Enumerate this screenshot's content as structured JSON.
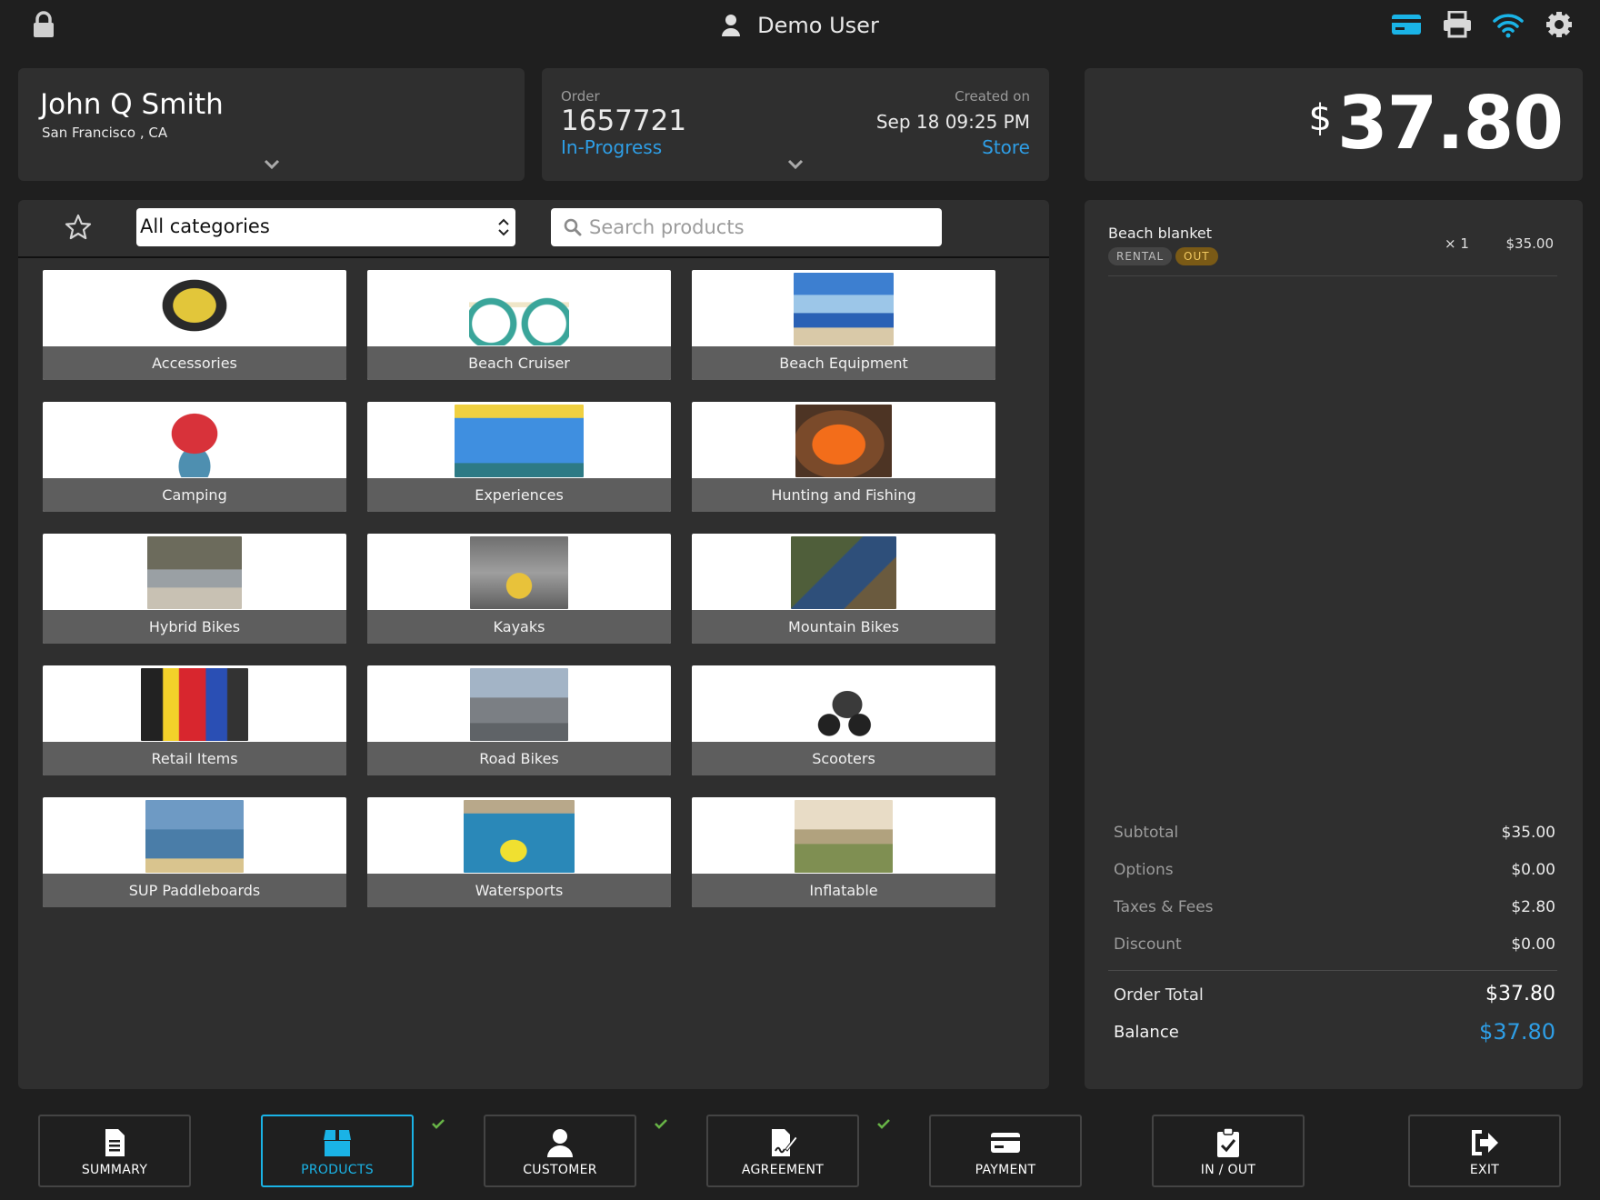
{
  "header": {
    "user_name": "Demo User",
    "accent_color": "#1ab3e6",
    "icons": [
      "lock-icon",
      "user-icon",
      "card-icon",
      "printer-icon",
      "wifi-icon",
      "gear-icon"
    ]
  },
  "customer": {
    "name": "John Q Smith",
    "location": "San Francisco , CA"
  },
  "order": {
    "label": "Order",
    "number": "1657721",
    "status": "In-Progress",
    "created_label": "Created on",
    "created_date": "Sep 18 09:25 PM",
    "source": "Store"
  },
  "total": {
    "currency": "$",
    "amount": "37.80"
  },
  "toolbar": {
    "category_selected": "All categories",
    "search_placeholder": "Search products"
  },
  "categories": [
    {
      "label": "Accessories"
    },
    {
      "label": "Beach Cruiser"
    },
    {
      "label": "Beach Equipment"
    },
    {
      "label": "Camping"
    },
    {
      "label": "Experiences"
    },
    {
      "label": "Hunting and Fishing"
    },
    {
      "label": "Hybrid Bikes"
    },
    {
      "label": "Kayaks"
    },
    {
      "label": "Mountain Bikes"
    },
    {
      "label": "Retail Items"
    },
    {
      "label": "Road Bikes"
    },
    {
      "label": "Scooters"
    },
    {
      "label": "SUP Paddleboards"
    },
    {
      "label": "Watersports"
    },
    {
      "label": "Inflatable"
    }
  ],
  "cart": {
    "items": [
      {
        "name": "Beach blanket",
        "badge_type": "RENTAL",
        "badge_status": "OUT",
        "qty": "× 1",
        "price": "$35.00"
      }
    ]
  },
  "summary": {
    "subtotal_label": "Subtotal",
    "subtotal": "$35.00",
    "options_label": "Options",
    "options": "$0.00",
    "taxes_label": "Taxes & Fees",
    "taxes": "$2.80",
    "discount_label": "Discount",
    "discount": "$0.00",
    "order_total_label": "Order Total",
    "order_total": "$37.80",
    "balance_label": "Balance",
    "balance": "$37.80"
  },
  "nav": {
    "summary": "SUMMARY",
    "products": "PRODUCTS",
    "customer": "CUSTOMER",
    "agreement": "AGREEMENT",
    "payment": "PAYMENT",
    "inout": "IN / OUT",
    "exit": "EXIT"
  }
}
